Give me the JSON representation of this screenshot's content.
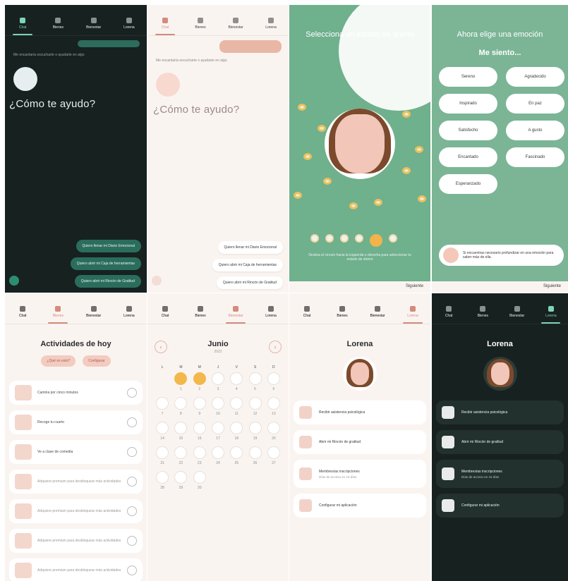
{
  "tabs": [
    "Chat",
    "Bienes",
    "Bienestar",
    "Lorena"
  ],
  "chat": {
    "hint": "Me encantaría escucharte o ayudarte en algo",
    "title": "¿Cómo te ayudo?",
    "quick_actions": [
      "Quiero llenar mi Diario Emocional",
      "Quiero abrir mi Caja de herramientas",
      "Quiero abrir mi Rincón de Gratitud"
    ]
  },
  "mood": {
    "title": "Selecciona un estado de ánimo",
    "caption": "Desliza el círculo hacia la izquierda o derecha para seleccionar tu estado de ánimo",
    "next": "Siguiente"
  },
  "emotion": {
    "title": "Ahora elige una emoción",
    "subtitle": "Me siento...",
    "options": [
      "Sereno",
      "Agradecido",
      "Inspirado",
      "En paz",
      "Satisfecho",
      "A gusto",
      "Encantado",
      "Fascinado",
      "Esperanzado"
    ],
    "note": "Si encuentras necesario profundizar en una emoción para saber más de ella.",
    "next": "Siguiente"
  },
  "activities": {
    "title": "Actividades de hoy",
    "chips": [
      "¿Qué es esto?",
      "Configurar"
    ],
    "items": [
      {
        "label": "Camina por cinco minutos",
        "muted": false
      },
      {
        "label": "Recoge tu cuarto",
        "muted": false
      },
      {
        "label": "Ve a clase de comedia",
        "muted": false
      },
      {
        "label": "Adquiere premium para desbloquear más actividades",
        "muted": true
      },
      {
        "label": "Adquiere premium para desbloquear más actividades",
        "muted": true
      },
      {
        "label": "Adquiere premium para desbloquear más actividades",
        "muted": true
      },
      {
        "label": "Adquiere premium para desbloquear más actividades",
        "muted": true
      }
    ]
  },
  "calendar": {
    "month": "Junio",
    "year": "2022",
    "weekdays": [
      "L",
      "M",
      "M",
      "J",
      "V",
      "S",
      "D"
    ],
    "days": [
      {
        "n": "",
        "mood": false
      },
      {
        "n": "1",
        "mood": true
      },
      {
        "n": "2",
        "mood": true
      },
      {
        "n": "3",
        "mood": false
      },
      {
        "n": "4",
        "mood": false
      },
      {
        "n": "5",
        "mood": false
      },
      {
        "n": "6",
        "mood": false
      },
      {
        "n": "7",
        "mood": false
      },
      {
        "n": "8",
        "mood": false
      },
      {
        "n": "9",
        "mood": false
      },
      {
        "n": "10",
        "mood": false
      },
      {
        "n": "11",
        "mood": false
      },
      {
        "n": "12",
        "mood": false
      },
      {
        "n": "13",
        "mood": false
      },
      {
        "n": "14",
        "mood": false
      },
      {
        "n": "15",
        "mood": false
      },
      {
        "n": "16",
        "mood": false
      },
      {
        "n": "17",
        "mood": false
      },
      {
        "n": "18",
        "mood": false
      },
      {
        "n": "19",
        "mood": false
      },
      {
        "n": "20",
        "mood": false
      },
      {
        "n": "21",
        "mood": false
      },
      {
        "n": "22",
        "mood": false
      },
      {
        "n": "23",
        "mood": false
      },
      {
        "n": "24",
        "mood": false
      },
      {
        "n": "25",
        "mood": false
      },
      {
        "n": "26",
        "mood": false
      },
      {
        "n": "27",
        "mood": false
      },
      {
        "n": "28",
        "mood": false
      },
      {
        "n": "29",
        "mood": false
      },
      {
        "n": "30",
        "mood": false
      }
    ]
  },
  "profile": {
    "name": "Lorena",
    "items": [
      {
        "label": "Recibir asistencia psicológica",
        "sub": ""
      },
      {
        "label": "Abrir mi Rincón de gratitud",
        "sub": ""
      },
      {
        "label": "Membresías inscripciones",
        "sub": "Días de acceso en 15 días"
      },
      {
        "label": "Configurar mi aplicación",
        "sub": ""
      }
    ]
  }
}
